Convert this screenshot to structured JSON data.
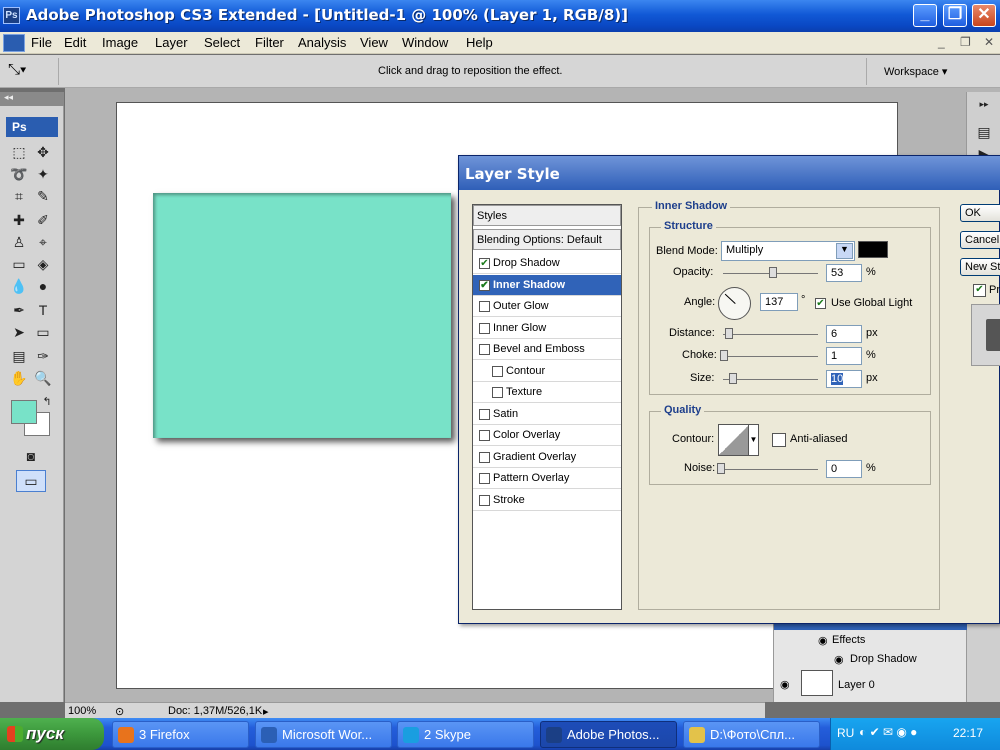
{
  "window": {
    "title": "Adobe Photoshop CS3 Extended - [Untitled-1 @ 100% (Layer 1, RGB/8)]",
    "logo": "Ps"
  },
  "menu": [
    "File",
    "Edit",
    "Image",
    "Layer",
    "Select",
    "Filter",
    "Analysis",
    "View",
    "Window",
    "Help"
  ],
  "options_bar": {
    "hint": "Click and drag to reposition the effect.",
    "workspace": "Workspace ▾"
  },
  "tools": {
    "logo": "Ps"
  },
  "colors": {
    "foreground": "#78e2c8",
    "background": "#ffffff",
    "shape_fill": "#78e2c8",
    "selection": "#3063b8"
  },
  "status": {
    "zoom": "100%",
    "doc": "Doc: 1,37M/526,1K"
  },
  "dialog": {
    "title": "Layer Style",
    "styles_header": "Styles",
    "blending": "Blending Options: Default",
    "items": [
      {
        "label": "Drop Shadow",
        "checked": true,
        "selected": false,
        "indent": false
      },
      {
        "label": "Inner Shadow",
        "checked": true,
        "selected": true,
        "indent": false
      },
      {
        "label": "Outer Glow",
        "checked": false,
        "selected": false,
        "indent": false
      },
      {
        "label": "Inner Glow",
        "checked": false,
        "selected": false,
        "indent": false
      },
      {
        "label": "Bevel and Emboss",
        "checked": false,
        "selected": false,
        "indent": false
      },
      {
        "label": "Contour",
        "checked": false,
        "selected": false,
        "indent": true
      },
      {
        "label": "Texture",
        "checked": false,
        "selected": false,
        "indent": true
      },
      {
        "label": "Satin",
        "checked": false,
        "selected": false,
        "indent": false
      },
      {
        "label": "Color Overlay",
        "checked": false,
        "selected": false,
        "indent": false
      },
      {
        "label": "Gradient Overlay",
        "checked": false,
        "selected": false,
        "indent": false
      },
      {
        "label": "Pattern Overlay",
        "checked": false,
        "selected": false,
        "indent": false
      },
      {
        "label": "Stroke",
        "checked": false,
        "selected": false,
        "indent": false
      }
    ],
    "section": "Inner Shadow",
    "structure": {
      "title": "Structure",
      "blend_mode_label": "Blend Mode:",
      "blend_mode": "Multiply",
      "shadow_color": "#000000",
      "opacity_label": "Opacity:",
      "opacity": "53",
      "opacity_unit": "%",
      "angle_label": "Angle:",
      "angle": "137",
      "angle_unit": "°",
      "global_light": "Use Global Light",
      "distance_label": "Distance:",
      "distance": "6",
      "distance_unit": "px",
      "choke_label": "Choke:",
      "choke": "1",
      "choke_unit": "%",
      "size_label": "Size:",
      "size": "10",
      "size_unit": "px"
    },
    "quality": {
      "title": "Quality",
      "contour_label": "Contour:",
      "anti_aliased": "Anti-aliased",
      "noise_label": "Noise:",
      "noise": "0",
      "noise_unit": "%"
    },
    "buttons": {
      "ok": "OK",
      "cancel": "Cancel",
      "new_style": "New Style...",
      "preview": "Preview"
    }
  },
  "layers": {
    "effects": "Effects",
    "drop_shadow": "Drop Shadow",
    "layer0": "Layer 0"
  },
  "taskbar": {
    "start": "пуск",
    "tasks": [
      {
        "label": "3 Firefox",
        "color": "#e8731c"
      },
      {
        "label": "Microsoft Wor...",
        "color": "#2b5fb5"
      },
      {
        "label": "2 Skype",
        "color": "#1a9ee0"
      },
      {
        "label": "Adobe Photos...",
        "color": "#1b3f85"
      },
      {
        "label": "D:\\Фото\\Спл...",
        "color": "#e3c24a"
      }
    ],
    "lang": "RU",
    "clock": "22:17"
  }
}
